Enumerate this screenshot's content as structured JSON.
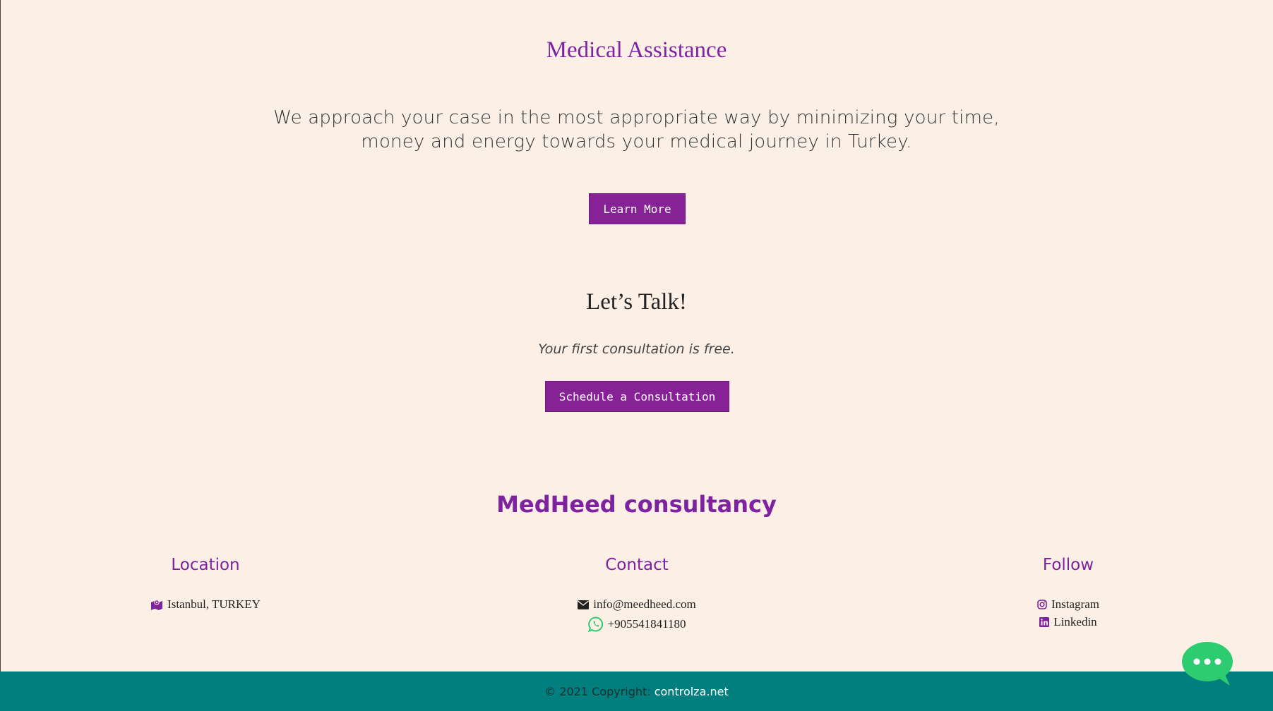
{
  "hero": {
    "title": "Medical Assistance",
    "description": "We approach your case in the most appropriate way by minimizing your time, money and energy towards your medical journey in Turkey.",
    "learn_more_label": "Learn More"
  },
  "talk": {
    "title": "Let’s Talk!",
    "subtitle": "Your first consultation is free.",
    "schedule_label": "Schedule a Consultation"
  },
  "brand": {
    "name": "MedHeed consultancy"
  },
  "footer_columns": {
    "location": {
      "title": "Location",
      "text": "Istanbul, TURKEY",
      "icon": "map-icon"
    },
    "contact": {
      "title": "Contact",
      "email": "info@meedheed.com",
      "email_icon": "envelope-icon",
      "phone": "+905541841180",
      "phone_icon": "whatsapp-icon"
    },
    "follow": {
      "title": "Follow",
      "instagram": "Instagram",
      "instagram_icon": "instagram-icon",
      "linkedin": "Linkedin",
      "linkedin_icon": "linkedin-icon"
    }
  },
  "footer": {
    "copyright": "© 2021 Copyright:",
    "link_text": "controlza.net"
  },
  "colors": {
    "background": "#fcefe6",
    "accent": "#7e22a0",
    "button": "#862196",
    "footer": "#017e7e",
    "chat": "#2ecc71"
  },
  "chat_widget": {
    "icon": "chat-bubble-icon"
  }
}
